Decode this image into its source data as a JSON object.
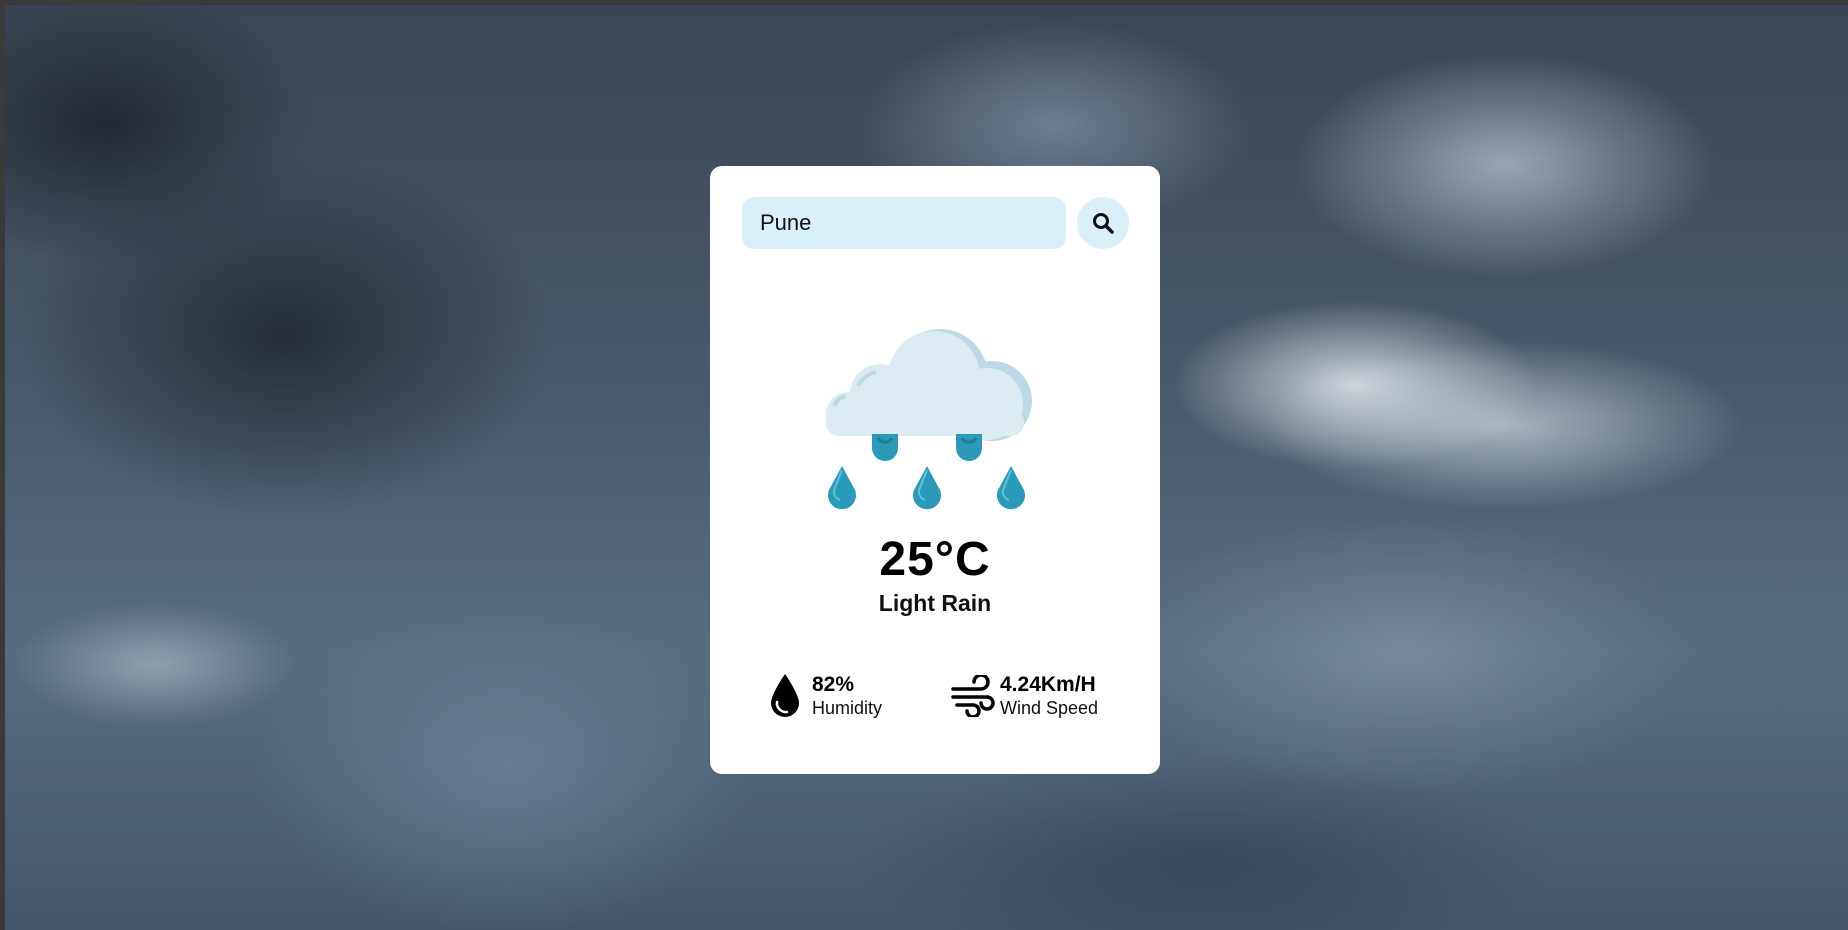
{
  "search": {
    "value": "Pune",
    "button_icon": "search-icon"
  },
  "weather": {
    "icon": "rain-cloud-icon",
    "temperature": "25°C",
    "condition": "Light Rain"
  },
  "stats": {
    "humidity": {
      "icon": "water-drop-icon",
      "value": "82%",
      "label": "Humidity"
    },
    "wind": {
      "icon": "wind-icon",
      "value": "4.24Km/H",
      "label": "Wind Speed"
    }
  },
  "colors": {
    "input_bg": "#d9f0f8",
    "cloud": "#dcebf1",
    "cloud_shadow": "#bcd9e6",
    "rain_drop": "#2a9ab8"
  }
}
